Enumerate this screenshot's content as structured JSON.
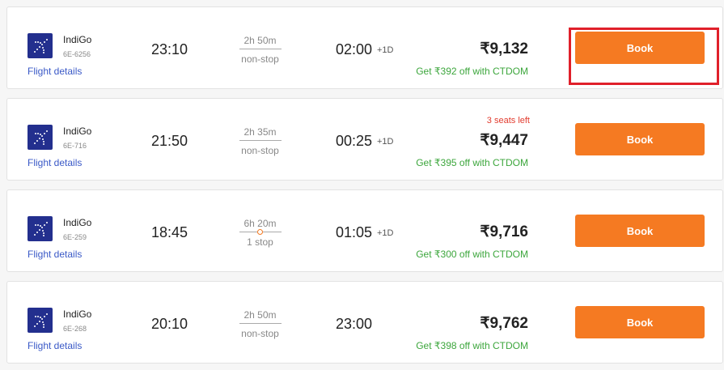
{
  "colors": {
    "accent": "#f57a22",
    "link": "#3a59c7",
    "offer": "#3ca63c",
    "alert": "#e23c2f",
    "highlight": "#e0202a",
    "airline_logo_bg": "#232f8e"
  },
  "flights": [
    {
      "airline": "IndiGo",
      "flight_code": "6E-6256",
      "details_link": "Flight details",
      "departure": "23:10",
      "duration": "2h 50m",
      "stops": "non-stop",
      "arrival": "02:00",
      "next_day": "+1D",
      "seats_left": "",
      "price": "₹9,132",
      "offer": "Get ₹392 off with CTDOM",
      "book_label": "Book",
      "logo_icon": "indigo-plane-logo"
    },
    {
      "airline": "IndiGo",
      "flight_code": "6E-716",
      "details_link": "Flight details",
      "departure": "21:50",
      "duration": "2h 35m",
      "stops": "non-stop",
      "arrival": "00:25",
      "next_day": "+1D",
      "seats_left": "3 seats left",
      "price": "₹9,447",
      "offer": "Get ₹395 off with CTDOM",
      "book_label": "Book",
      "logo_icon": "indigo-plane-logo"
    },
    {
      "airline": "IndiGo",
      "flight_code": "6E-259",
      "details_link": "Flight details",
      "departure": "18:45",
      "duration": "6h 20m",
      "stops": "1 stop",
      "arrival": "01:05",
      "next_day": "+1D",
      "seats_left": "",
      "price": "₹9,716",
      "offer": "Get ₹300 off with CTDOM",
      "book_label": "Book",
      "logo_icon": "indigo-plane-logo"
    },
    {
      "airline": "IndiGo",
      "flight_code": "6E-268",
      "details_link": "Flight details",
      "departure": "20:10",
      "duration": "2h 50m",
      "stops": "non-stop",
      "arrival": "23:00",
      "next_day": "",
      "seats_left": "",
      "price": "₹9,762",
      "offer": "Get ₹398 off with CTDOM",
      "book_label": "Book",
      "logo_icon": "indigo-plane-logo"
    }
  ]
}
